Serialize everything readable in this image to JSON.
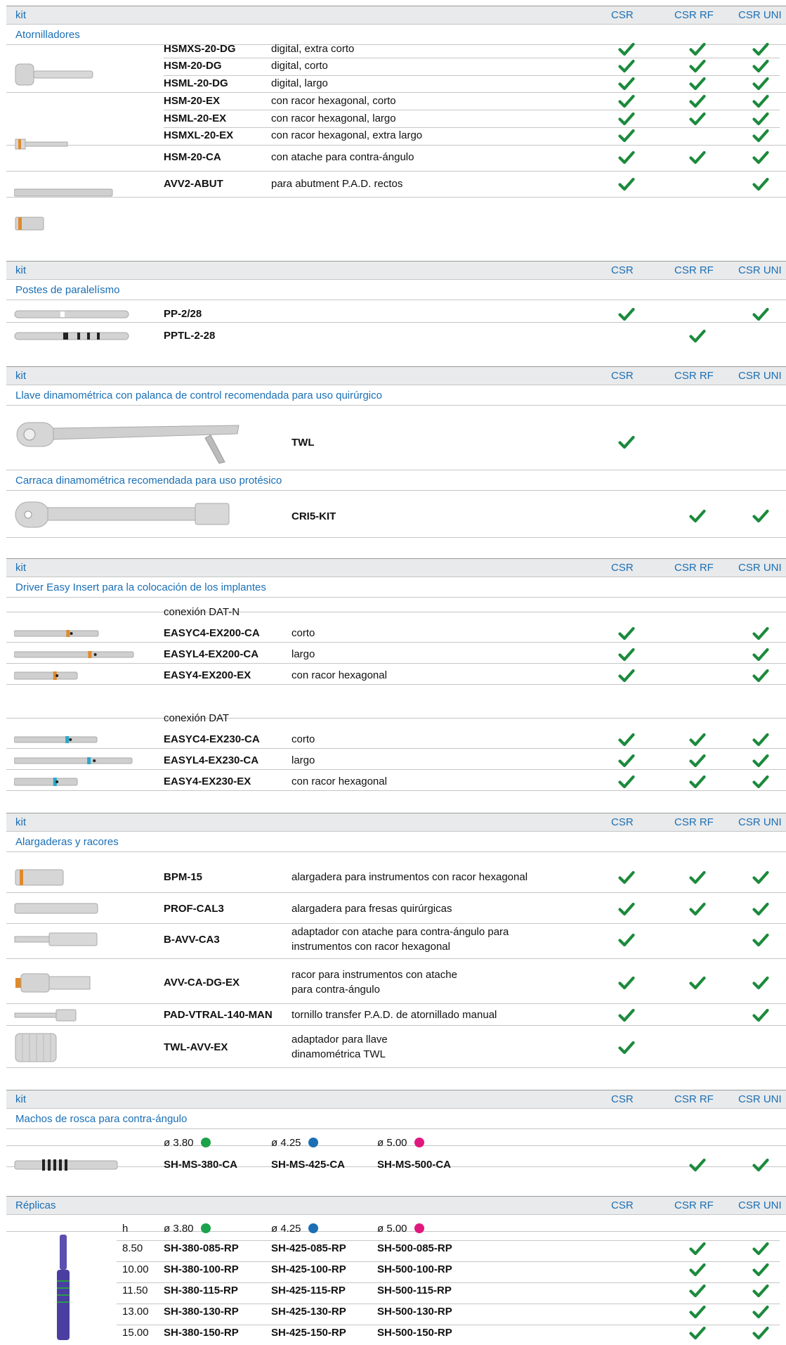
{
  "colors": {
    "accent": "#1a6fb5",
    "check": "#1b8a3c",
    "header_bg": "#e9eaeb",
    "dot_green": "#1aa34a",
    "dot_blue": "#1a6fb5",
    "dot_pink": "#e0187e"
  },
  "icons": {
    "check": "check-icon",
    "product": "instrument-image"
  },
  "columns": {
    "kit": "kit",
    "csr": "CSR",
    "csr_rf": "CSR RF",
    "csr_uni": "CSR UNI",
    "replicas": "Réplicas"
  },
  "sections": [
    {
      "category": "Atornilladores",
      "rows": [
        {
          "code": "HSMXS-20-DG",
          "desc": "digital, extra corto",
          "csr": true,
          "rf": true,
          "uni": true
        },
        {
          "code": "HSM-20-DG",
          "desc": "digital, corto",
          "csr": true,
          "rf": true,
          "uni": true
        },
        {
          "code": "HSML-20-DG",
          "desc": "digital, largo",
          "csr": true,
          "rf": true,
          "uni": true
        },
        {
          "code": "HSM-20-EX",
          "desc": "con racor hexagonal, corto",
          "csr": true,
          "rf": true,
          "uni": true
        },
        {
          "code": "HSML-20-EX",
          "desc": "con racor hexagonal, largo",
          "csr": true,
          "rf": true,
          "uni": true
        },
        {
          "code": "HSMXL-20-EX",
          "desc": "con racor hexagonal, extra largo",
          "csr": true,
          "rf": false,
          "uni": true
        },
        {
          "code": "HSM-20-CA",
          "desc": "con atache para contra-ángulo",
          "csr": true,
          "rf": true,
          "uni": true
        },
        {
          "code": "AVV2-ABUT",
          "desc": "para abutment P.A.D. rectos",
          "csr": true,
          "rf": false,
          "uni": true
        }
      ]
    },
    {
      "category": "Postes de paralelísmo",
      "rows": [
        {
          "code": "PP-2/28",
          "csr": true,
          "rf": false,
          "uni": true
        },
        {
          "code": "PPTL-2-28",
          "csr": false,
          "rf": true,
          "uni": false
        }
      ]
    },
    {
      "category": "Llave dinamométrica con palanca de control recomendada para uso quirúrgico",
      "rows": [
        {
          "code": "TWL",
          "csr": true,
          "rf": false,
          "uni": false
        }
      ],
      "category2": "Carraca dinamométrica recomendada para uso protésico",
      "rows2": [
        {
          "code": "CRI5-KIT",
          "csr": false,
          "rf": true,
          "uni": true
        }
      ]
    },
    {
      "category": "Driver Easy Insert para la colocación de los implantes",
      "group1": "conexión DAT-N",
      "rows1": [
        {
          "code": "EASYC4-EX200-CA",
          "desc": "corto",
          "csr": true,
          "rf": false,
          "uni": true
        },
        {
          "code": "EASYL4-EX200-CA",
          "desc": "largo",
          "csr": true,
          "rf": false,
          "uni": true
        },
        {
          "code": "EASY4-EX200-EX",
          "desc": "con racor hexagonal",
          "csr": true,
          "rf": false,
          "uni": true
        }
      ],
      "group2": "conexión DAT",
      "rows2": [
        {
          "code": "EASYC4-EX230-CA",
          "desc": "corto",
          "csr": true,
          "rf": true,
          "uni": true
        },
        {
          "code": "EASYL4-EX230-CA",
          "desc": "largo",
          "csr": true,
          "rf": true,
          "uni": true
        },
        {
          "code": "EASY4-EX230-EX",
          "desc": "con racor hexagonal",
          "csr": true,
          "rf": true,
          "uni": true
        }
      ]
    },
    {
      "category": "Alargaderas y racores",
      "rows": [
        {
          "code": "BPM-15",
          "desc1": "alargadera para instrumentos con racor hexagonal",
          "desc2": "",
          "csr": true,
          "rf": true,
          "uni": true
        },
        {
          "code": "PROF-CAL3",
          "desc1": "alargadera para fresas quirúrgicas",
          "desc2": "",
          "csr": true,
          "rf": true,
          "uni": true
        },
        {
          "code": "B-AVV-CA3",
          "desc1": "adaptador con atache para contra-ángulo para",
          "desc2": "instrumentos con racor hexagonal",
          "csr": true,
          "rf": false,
          "uni": true
        },
        {
          "code": "AVV-CA-DG-EX",
          "desc1": "racor para instrumentos con atache",
          "desc2": "para contra-ángulo",
          "csr": true,
          "rf": true,
          "uni": true
        },
        {
          "code": "PAD-VTRAL-140-MAN",
          "desc1": "tornillo transfer P.A.D. de atornillado manual",
          "desc2": "",
          "csr": true,
          "rf": false,
          "uni": true
        },
        {
          "code": "TWL-AVV-EX",
          "desc1": "adaptador para llave",
          "desc2": "dinamométrica TWL",
          "csr": true,
          "rf": false,
          "uni": false
        }
      ]
    },
    {
      "category": "Machos de rosca para contra-ángulo",
      "diam": [
        "ø 3.80",
        "ø 4.25",
        "ø 5.00"
      ],
      "codes": [
        "SH-MS-380-CA",
        "SH-MS-425-CA",
        "SH-MS-500-CA"
      ],
      "csr": false,
      "rf": true,
      "uni": true
    },
    {
      "h_label": "h",
      "diam": [
        "ø 3.80",
        "ø 4.25",
        "ø 5.00"
      ],
      "rows": [
        {
          "h": "8.50",
          "c1": "SH-380-085-RP",
          "c2": "SH-425-085-RP",
          "c3": "SH-500-085-RP",
          "csr": false,
          "rf": true,
          "uni": true
        },
        {
          "h": "10.00",
          "c1": "SH-380-100-RP",
          "c2": "SH-425-100-RP",
          "c3": "SH-500-100-RP",
          "csr": false,
          "rf": true,
          "uni": true
        },
        {
          "h": "11.50",
          "c1": "SH-380-115-RP",
          "c2": "SH-425-115-RP",
          "c3": "SH-500-115-RP",
          "csr": false,
          "rf": true,
          "uni": true
        },
        {
          "h": "13.00",
          "c1": "SH-380-130-RP",
          "c2": "SH-425-130-RP",
          "c3": "SH-500-130-RP",
          "csr": false,
          "rf": true,
          "uni": true
        },
        {
          "h": "15.00",
          "c1": "SH-380-150-RP",
          "c2": "SH-425-150-RP",
          "c3": "SH-500-150-RP",
          "csr": false,
          "rf": true,
          "uni": true
        }
      ]
    }
  ]
}
